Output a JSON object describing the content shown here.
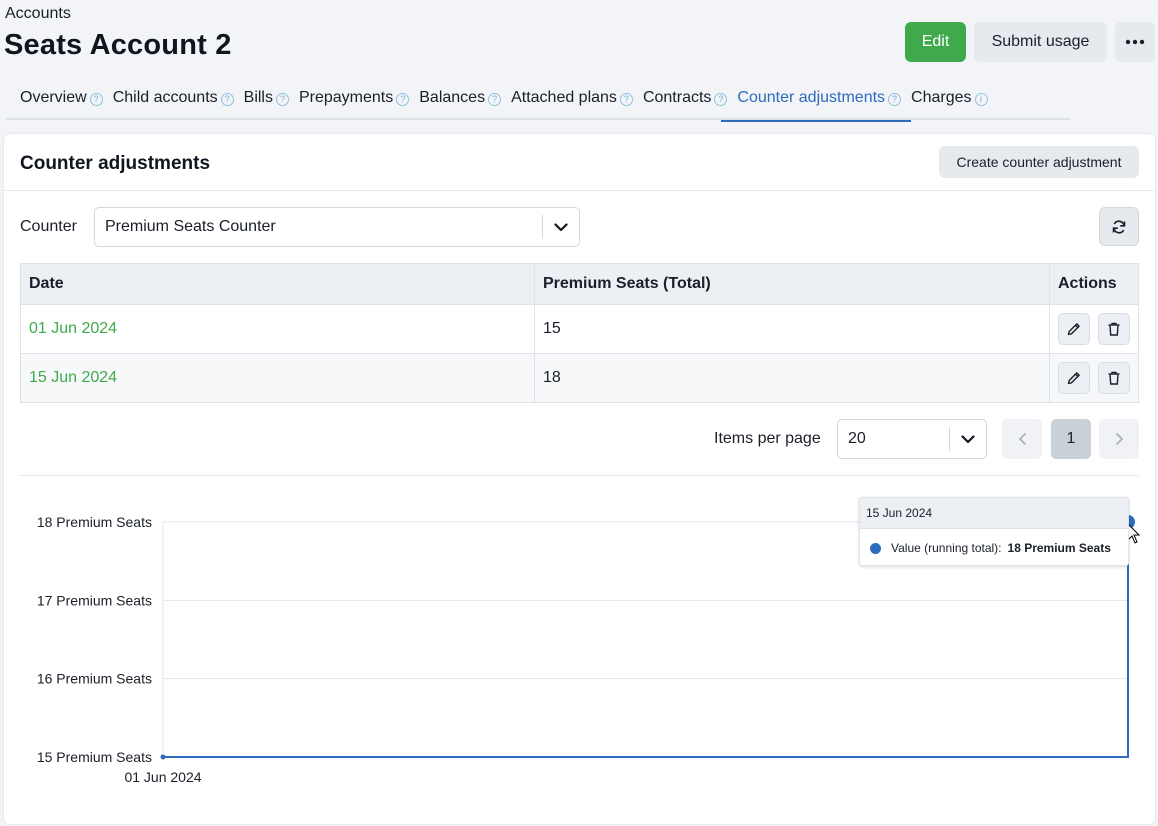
{
  "header": {
    "breadcrumb": "Accounts",
    "title": "Seats Account 2",
    "edit_label": "Edit",
    "submit_label": "Submit usage",
    "more_icon": "more-horizontal-icon"
  },
  "tabs": [
    {
      "label": "Overview",
      "active": false,
      "icon": "question-icon"
    },
    {
      "label": "Child accounts",
      "active": false,
      "icon": "question-icon"
    },
    {
      "label": "Bills",
      "active": false,
      "icon": "question-icon"
    },
    {
      "label": "Prepayments",
      "active": false,
      "icon": "question-icon"
    },
    {
      "label": "Balances",
      "active": false,
      "icon": "question-icon"
    },
    {
      "label": "Attached plans",
      "active": false,
      "icon": "question-icon"
    },
    {
      "label": "Contracts",
      "active": false,
      "icon": "question-icon"
    },
    {
      "label": "Counter adjustments",
      "active": true,
      "icon": "question-icon"
    },
    {
      "label": "Charges",
      "active": false,
      "icon": "info-icon"
    }
  ],
  "panel": {
    "title": "Counter adjustments",
    "create_label": "Create counter adjustment",
    "counter_label": "Counter",
    "counter_value": "Premium Seats Counter"
  },
  "table": {
    "headers": [
      "Date",
      "Premium Seats (Total)",
      "Actions"
    ],
    "rows": [
      {
        "date": "01 Jun 2024",
        "total": "15"
      },
      {
        "date": "15 Jun 2024",
        "total": "18"
      }
    ]
  },
  "pagination": {
    "items_per_page_label": "Items per page",
    "items_per_page_value": "20",
    "current_page": "1"
  },
  "tooltip": {
    "date": "15 Jun 2024",
    "key": "Value (running total):",
    "value": "18 Premium Seats"
  },
  "colors": {
    "accent": "#2e6bbd",
    "success": "#3faa4b"
  },
  "chart_data": {
    "type": "line",
    "x": [
      "01 Jun 2024",
      "15 Jun 2024"
    ],
    "series": [
      {
        "name": "Value (running total)",
        "values": [
          15,
          18
        ]
      }
    ],
    "y_ticks": [
      {
        "value": 18,
        "label": "18 Premium Seats"
      },
      {
        "value": 17,
        "label": "17 Premium Seats"
      },
      {
        "value": 16,
        "label": "16 Premium Seats"
      },
      {
        "value": 15,
        "label": "15 Premium Seats"
      }
    ],
    "x_tick_labels": [
      "01 Jun 2024"
    ],
    "ylim": [
      15,
      18
    ],
    "step": true,
    "grid": true
  }
}
